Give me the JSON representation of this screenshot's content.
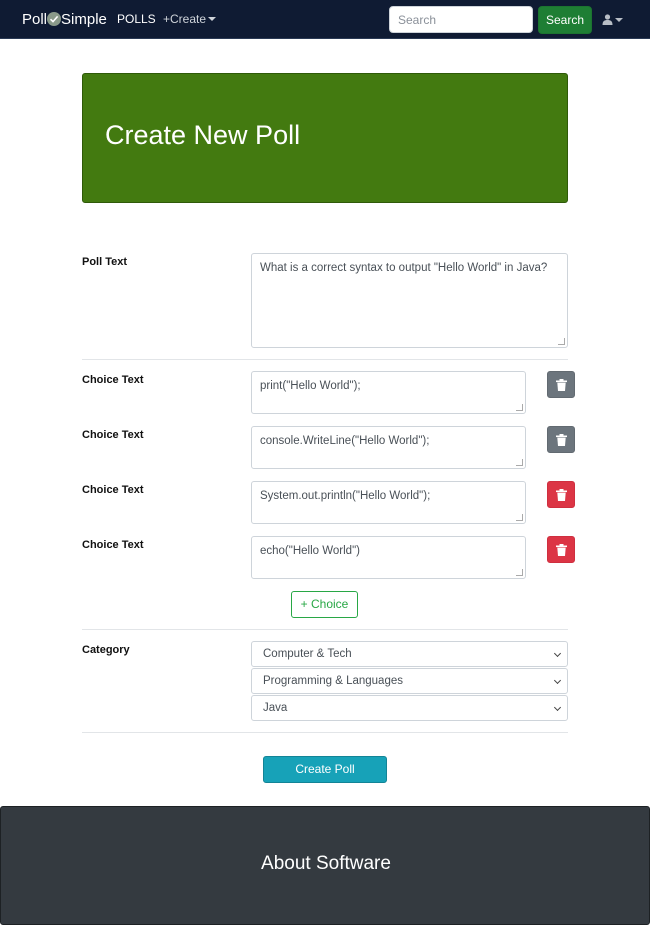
{
  "navbar": {
    "brand_left": "Poll",
    "brand_right": "Simple",
    "polls": "POLLS",
    "create": "+Create",
    "search_placeholder": "Search",
    "search_button": "Search"
  },
  "header": {
    "title": "Create New Poll"
  },
  "form": {
    "poll_label": "Poll Text",
    "poll_text": "What is a correct syntax to output \"Hello World\" in Java?",
    "choice_label": "Choice Text",
    "choices": [
      {
        "text": "print(\"Hello World\");",
        "delete_color": "#6c757d"
      },
      {
        "text": "console.WriteLine(\"Hello World\");",
        "delete_color": "#6c757d"
      },
      {
        "text": "System.out.println(\"Hello World\");",
        "delete_color": "#dc3545"
      },
      {
        "text": "echo(\"Hello World\")",
        "delete_color": "#dc3545"
      }
    ],
    "add_choice": "+ Choice",
    "category_label": "Category",
    "categories": [
      "Computer & Tech",
      "Programming & Languages",
      "Java"
    ],
    "submit": "Create Poll"
  },
  "footer": {
    "title": "About Software"
  },
  "colors": {
    "header_bg": "#437a10",
    "navbar_bg": "#0f1b33",
    "footer_bg": "#343a40"
  }
}
